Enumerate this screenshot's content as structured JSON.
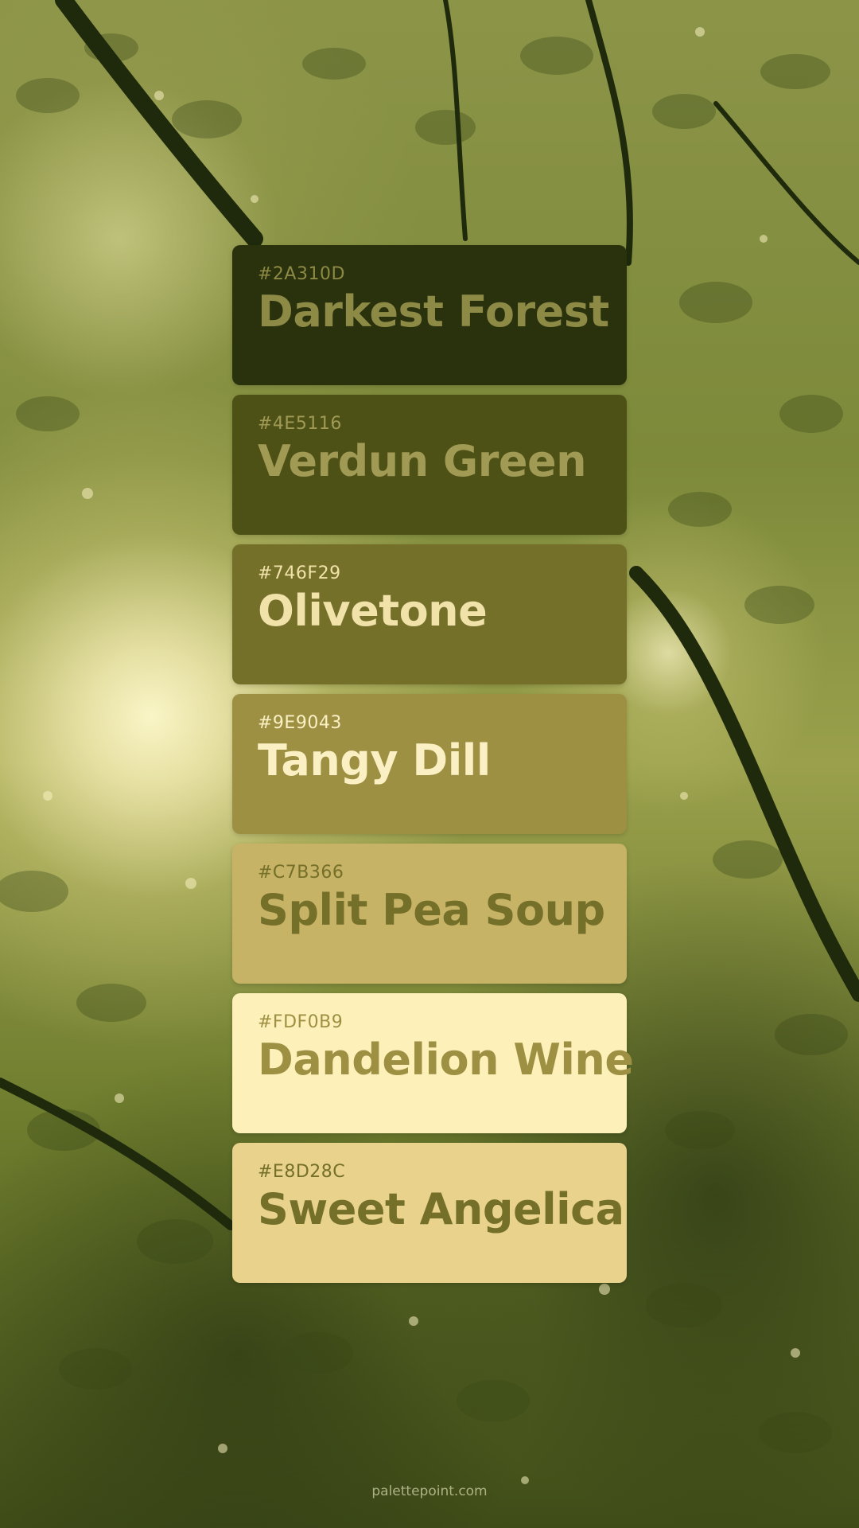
{
  "swatches": [
    {
      "hex": "#2A310D",
      "name": "Darkest Forest",
      "bg": "#2A310D",
      "text": "#8C8A45"
    },
    {
      "hex": "#4E5116",
      "name": "Verdun Green",
      "bg": "#4E5116",
      "text": "#A09A55"
    },
    {
      "hex": "#746F29",
      "name": "Olivetone",
      "bg": "#746F29",
      "text": "#F0E2A8"
    },
    {
      "hex": "#9E9043",
      "name": "Tangy Dill",
      "bg": "#9E9043",
      "text": "#FBF0C4"
    },
    {
      "hex": "#C7B366",
      "name": "Split Pea Soup",
      "bg": "#C7B366",
      "text": "#746F29"
    },
    {
      "hex": "#FDF0B9",
      "name": "Dandelion Wine",
      "bg": "#FDF0B9",
      "text": "#9E9043"
    },
    {
      "hex": "#E8D28C",
      "name": "Sweet Angelica",
      "bg": "#E8D28C",
      "text": "#746F29"
    }
  ],
  "footer": {
    "text": "palettepoint.com"
  }
}
